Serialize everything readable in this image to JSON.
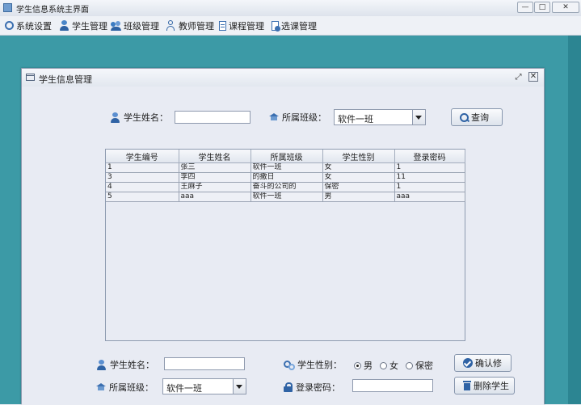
{
  "window": {
    "title": "学生信息系统主界面",
    "min": "—",
    "max": "□",
    "close": "✕"
  },
  "menubar": [
    {
      "label": "系统设置",
      "icon": "gear-icon"
    },
    {
      "label": "学生管理",
      "icon": "student-icon"
    },
    {
      "label": "班级管理",
      "icon": "class-icon"
    },
    {
      "label": "教师管理",
      "icon": "teacher-icon"
    },
    {
      "label": "课程管理",
      "icon": "course-icon"
    },
    {
      "label": "选课管理",
      "icon": "select-course-icon"
    }
  ],
  "frame": {
    "title": "学生信息管理",
    "restore": "⤢",
    "close": "✕"
  },
  "search": {
    "name_label": "学生姓名：",
    "name_value": "",
    "class_label": "所属班级：",
    "class_value": "软件一班",
    "button": "查询"
  },
  "table": {
    "columns": [
      "学生编号",
      "学生姓名",
      "所属班级",
      "学生性别",
      "登录密码"
    ],
    "rows": [
      [
        "1",
        "张三",
        "软件一班",
        "女",
        "1"
      ],
      [
        "3",
        "李四",
        "的撒日",
        "女",
        "11"
      ],
      [
        "4",
        "王麻子",
        "奋斗的公司的",
        "保密",
        "1"
      ],
      [
        "5",
        "aaa",
        "软件一班",
        "男",
        "aaa"
      ]
    ]
  },
  "edit": {
    "name_label": "学生姓名：",
    "name_value": "",
    "gender_label": "学生性别：",
    "gender_options": [
      "男",
      "女",
      "保密"
    ],
    "gender_selected": "男",
    "class_label": "所属班级：",
    "class_value": "软件一班",
    "password_label": "登录密码：",
    "password_value": "",
    "confirm_button": "确认修",
    "delete_button": "删除学生"
  }
}
